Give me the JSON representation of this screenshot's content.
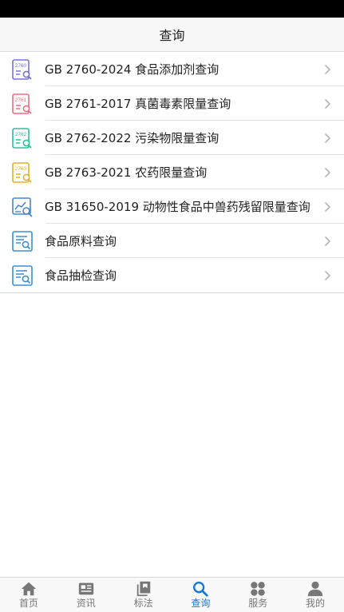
{
  "header": {
    "title": "查询"
  },
  "list": {
    "items": [
      {
        "label": "GB 2760-2024 食品添加剂查询",
        "icon": "gb2760-doc-icon",
        "icon_text": "2760",
        "color": "#7a73d6"
      },
      {
        "label": "GB 2761-2017 真菌毒素限量查询",
        "icon": "gb2761-doc-icon",
        "icon_text": "2761",
        "color": "#ec6e86"
      },
      {
        "label": "GB 2762-2022 污染物限量查询",
        "icon": "gb2762-doc-icon",
        "icon_text": "2762",
        "color": "#2bbf9a"
      },
      {
        "label": "GB 2763-2021 农药限量查询",
        "icon": "gb2763-doc-icon",
        "icon_text": "2763",
        "color": "#e0b22a"
      },
      {
        "label": "GB 31650-2019 动物性食品中兽药残留限量查询",
        "icon": "chart-search-icon",
        "color": "#4a86c8"
      },
      {
        "label": "食品原料查询",
        "icon": "document-search-icon",
        "color": "#3a8fd6"
      },
      {
        "label": "食品抽检查询",
        "icon": "document-search-icon",
        "color": "#3a8fd6"
      }
    ]
  },
  "tabbar": {
    "items": [
      {
        "label": "首页",
        "icon": "home-icon",
        "active": false
      },
      {
        "label": "资讯",
        "icon": "news-icon",
        "active": false
      },
      {
        "label": "标法",
        "icon": "book-icon",
        "active": false
      },
      {
        "label": "查询",
        "icon": "search-icon",
        "active": true
      },
      {
        "label": "服务",
        "icon": "grid-icon",
        "active": false
      },
      {
        "label": "我的",
        "icon": "user-icon",
        "active": false
      }
    ],
    "active_color": "#1478d4",
    "inactive_color": "#777777"
  }
}
